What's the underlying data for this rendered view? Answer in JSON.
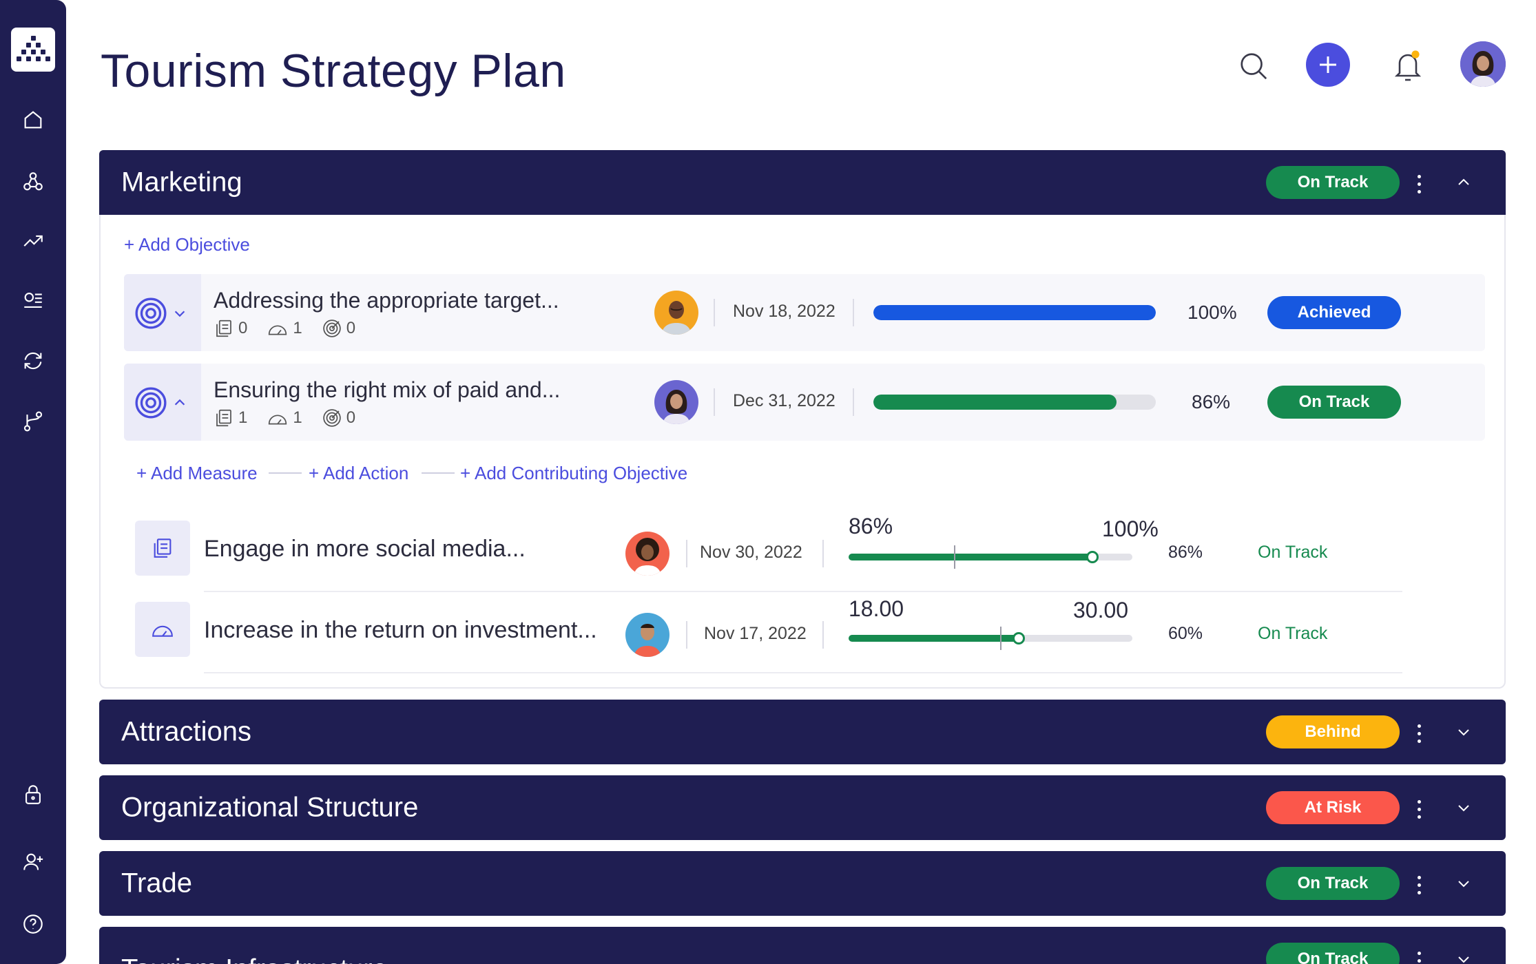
{
  "page": {
    "title": "Tourism Strategy Plan"
  },
  "colors": {
    "navy": "#1f1e52",
    "accent": "#4b4dde",
    "on_track": "#168a4f",
    "achieved": "#1758e0",
    "behind": "#fcb40e",
    "at_risk": "#fb574b"
  },
  "sidebar": {
    "logo_icon": "grid-triangle-logo",
    "items": [
      "home-icon",
      "network-icon",
      "trend-icon",
      "list-icon",
      "sync-icon",
      "branch-icon",
      "lock-icon",
      "add-user-icon",
      "help-icon"
    ]
  },
  "header": {
    "icons": [
      "search-icon",
      "plus-icon",
      "bell-icon",
      "user-avatar"
    ]
  },
  "sections": [
    {
      "title": "Marketing",
      "status": "On Track",
      "status_color": "#168a4f",
      "expanded": true
    },
    {
      "title": "Attractions",
      "status": "Behind",
      "status_color": "#fcb40e",
      "expanded": false
    },
    {
      "title": "Organizational Structure",
      "status": "At Risk",
      "status_color": "#fb574b",
      "expanded": false
    },
    {
      "title": "Trade",
      "status": "On Track",
      "status_color": "#168a4f",
      "expanded": false
    },
    {
      "title": "Tourism Infrastructure",
      "status": "On Track",
      "status_color": "#168a4f",
      "expanded": false
    }
  ],
  "marketing": {
    "add_objective": "+ Add Objective",
    "objectives": [
      {
        "title": "Addressing the appropriate target...",
        "measures": "0",
        "actions": "1",
        "contributing": "0",
        "date": "Nov 18, 2022",
        "progress": 100,
        "percent": "100%",
        "status": "Achieved",
        "status_color": "#1758e0",
        "bar_color": "#1758e0"
      },
      {
        "title": "Ensuring the right mix of paid and...",
        "measures": "1",
        "actions": "1",
        "contributing": "0",
        "date": "Dec 31, 2022",
        "progress": 86,
        "percent": "86%",
        "status": "On Track",
        "status_color": "#168a4f",
        "bar_color": "#168a4f"
      }
    ],
    "links": {
      "add_measure": "+ Add Measure",
      "add_action": "+ Add Action",
      "add_contributing": "+ Add Contributing Objective"
    },
    "measures": [
      {
        "title": "Engage in more social media...",
        "date": "Nov 30, 2022",
        "current_label": "86%",
        "target_label": "100%",
        "progress": 86,
        "percent": "86%",
        "status": "On Track"
      },
      {
        "title": "Increase in the return on investment...",
        "date": "Nov 17, 2022",
        "current_label": "18.00",
        "target_label": "30.00",
        "progress": 60,
        "percent": "60%",
        "status": "On Track"
      }
    ]
  }
}
